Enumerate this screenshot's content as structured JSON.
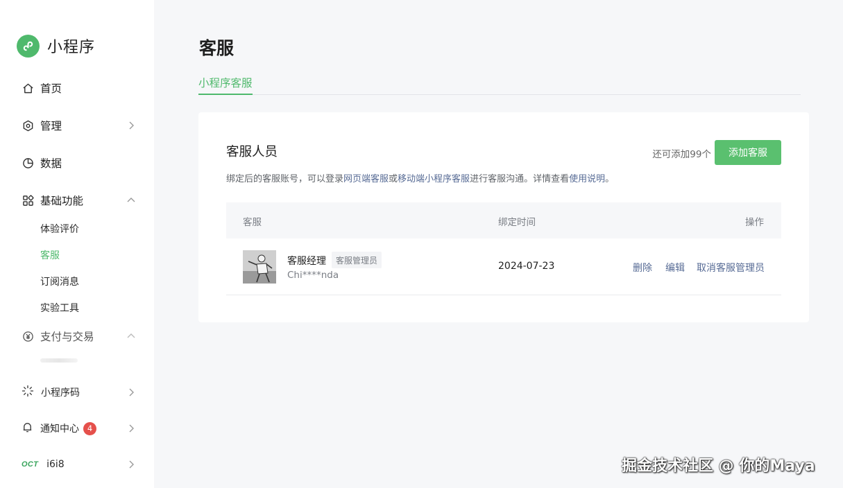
{
  "brand": {
    "name": "小程序",
    "accent": "#4fb96c"
  },
  "sidebar": {
    "items": [
      {
        "label": "首页",
        "icon": "home-icon"
      },
      {
        "label": "管理",
        "icon": "hexagon-settings-icon"
      },
      {
        "label": "数据",
        "icon": "pie-chart-icon"
      },
      {
        "label": "基础功能",
        "icon": "grid-icon"
      }
    ],
    "sub_items": [
      {
        "label": "体验评价"
      },
      {
        "label": "客服",
        "active": true
      },
      {
        "label": "订阅消息"
      },
      {
        "label": "实验工具"
      }
    ],
    "payment": {
      "label": "支付与交易",
      "icon": "yuan-coin-icon"
    },
    "bottom": {
      "qrcode": {
        "label": "小程序码",
        "icon": "sparkle-code-icon"
      },
      "notice": {
        "label": "通知中心",
        "badge": "4",
        "icon": "bell-icon"
      },
      "account": {
        "label": "i6i8",
        "logo_text": "OCT"
      }
    }
  },
  "page": {
    "title": "客服",
    "tabs": [
      {
        "label": "小程序客服"
      }
    ]
  },
  "card": {
    "title": "客服人员",
    "remain": "还可添加99个",
    "add_button": "添加客服",
    "desc": {
      "part1": "绑定后的客服账号，可以登录",
      "link1": "网页端客服",
      "part2": "或",
      "link2": "移动端小程序客服",
      "part3": "进行客服沟通。详情查看",
      "link3": "使用说明",
      "part4": "。"
    },
    "table": {
      "headers": {
        "cs": "客服",
        "time": "绑定时间",
        "op": "操作"
      },
      "rows": [
        {
          "name": "客服经理",
          "role": "客服管理员",
          "account": "Chi****nda",
          "bind_time": "2024-07-23",
          "ops": {
            "delete": "删除",
            "edit": "编辑",
            "revoke": "取消客服管理员"
          }
        }
      ]
    }
  },
  "watermark": "掘金技术社区 @ 你的Maya"
}
